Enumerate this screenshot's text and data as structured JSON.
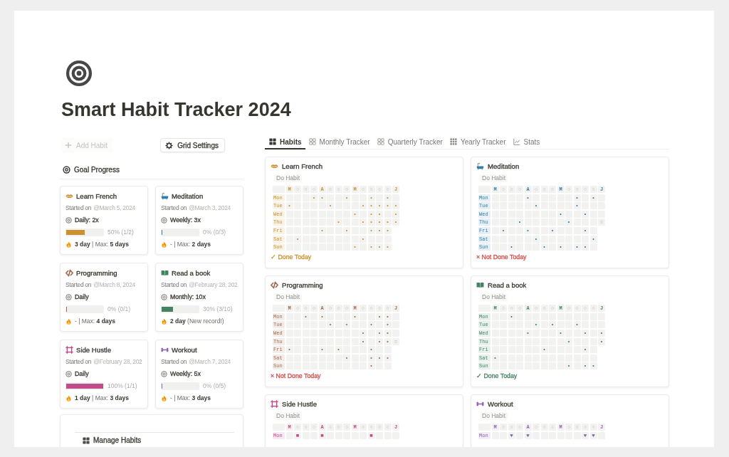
{
  "page": {
    "title": "Smart Habit Tracker 2024"
  },
  "toolbar": {
    "add_button": {
      "label": "Add Habit",
      "disabled": true
    },
    "settings_button": {
      "label": "Grid Settings"
    }
  },
  "goal_progress": {
    "heading": "Goal Progress",
    "cards": [
      {
        "title": "Learn French",
        "color": "#cb912f",
        "started_label": "Started on",
        "date": "@March 5, 2024",
        "frequency": "Daily: 2x",
        "level": 0.5,
        "progress": "50% (1/2)",
        "streak": "**3 day** | Max: **5 days**"
      },
      {
        "title": "Meditation",
        "color": "#337ea9",
        "started_label": "Started on",
        "date": "@March 3, 2024",
        "frequency": "Weekly: 3x",
        "level": 0,
        "progress": "0% (0/3)",
        "streak": "- | Max: **2 days**"
      },
      {
        "title": "Programming",
        "color": "#9f6b53",
        "started_label": "Started on",
        "date": "@March 8, 2024",
        "frequency": "Daily",
        "level": 0,
        "progress": "0% (0/1)",
        "streak": "- | Max: **4 days**"
      },
      {
        "title": "Read a book",
        "color": "#448361",
        "started_label": "Started on",
        "date": "@February 28, 202",
        "frequency": "Monthly: 10x",
        "level": 0.3,
        "progress": "30% (3/10)",
        "streak": "**2 day** (New record!)"
      },
      {
        "title": "Side Hustle",
        "color": "#c14c8a",
        "started_label": "Started on",
        "date": "@February 28, 202",
        "frequency": "Daily",
        "level": 1,
        "progress": "100% (1/1)",
        "streak": "**1 day** | Max: **3 days**"
      },
      {
        "title": "Workout",
        "color": "#9065b0",
        "started_label": "Started on",
        "date": "@March 7, 2024",
        "frequency": "Weekly: 5x",
        "level": 0,
        "progress": "0% (0/5)",
        "streak": "- | Max: **3 days**"
      }
    ]
  },
  "manage": {
    "label": "Manage Habits"
  },
  "tabs": [
    {
      "label": "Habits",
      "selected": true
    },
    {
      "label": "Monthly Tracker",
      "selected": false
    },
    {
      "label": "Quarterly Tracker",
      "selected": false
    },
    {
      "label": "Yearly Tracker",
      "selected": false
    },
    {
      "label": "Stats",
      "selected": false
    }
  ],
  "habits": [
    {
      "title": "Learn French",
      "color": "#cb912f",
      "action": "Do Habit",
      "weeks": [
        {
          "label": "M",
          "kind": "month"
        },
        {
          "label": "○",
          "kind": "week"
        },
        {
          "label": "○",
          "kind": "week"
        },
        {
          "label": "○",
          "kind": "week"
        },
        {
          "label": "A",
          "kind": "month"
        },
        {
          "label": "○",
          "kind": "week"
        },
        {
          "label": "○",
          "kind": "week"
        },
        {
          "label": "○",
          "kind": "week"
        },
        {
          "label": "M",
          "kind": "month"
        },
        {
          "label": "○",
          "kind": "week"
        },
        {
          "label": "○",
          "kind": "week"
        },
        {
          "label": "○",
          "kind": "week"
        },
        {
          "label": "○",
          "kind": "week"
        },
        {
          "label": "J",
          "kind": "month"
        }
      ],
      "rows": [
        {
          "day": "Mon",
          "cells": [
            null,
            null,
            null,
            {
              "mark": "•",
              "done": true
            },
            {
              "mark": "•",
              "done": true
            },
            null,
            null,
            {
              "mark": "•",
              "done": true
            },
            null,
            null,
            {
              "mark": "•",
              "done": true
            },
            null,
            {
              "mark": "•",
              "done": true
            },
            null
          ]
        },
        {
          "day": "Tue",
          "cells": [
            {
              "mark": "•",
              "done": true
            },
            null,
            null,
            null,
            null,
            {
              "mark": "•",
              "done": true
            },
            null,
            null,
            null,
            {
              "mark": "•",
              "done": true
            },
            {
              "mark": "•",
              "done": true
            },
            {
              "mark": "•",
              "done": true
            },
            {
              "mark": "•",
              "done": true
            },
            {
              "mark": "•",
              "done": true
            }
          ]
        },
        {
          "day": "Wed",
          "cells": [
            null,
            null,
            null,
            null,
            null,
            null,
            null,
            null,
            {
              "mark": "•",
              "done": true
            },
            null,
            {
              "mark": "•",
              "done": true
            },
            {
              "mark": "•",
              "done": true
            },
            null,
            {
              "mark": "•",
              "done": true
            }
          ]
        },
        {
          "day": "Thu",
          "cells": [
            null,
            null,
            null,
            null,
            null,
            null,
            {
              "mark": "•",
              "done": true
            },
            null,
            null,
            {
              "mark": "•",
              "done": true
            },
            {
              "mark": "•",
              "done": true
            },
            {
              "mark": "•",
              "done": true
            },
            {
              "mark": "•",
              "done": true
            },
            {
              "mark": "•",
              "done": true
            }
          ]
        },
        {
          "day": "Fri",
          "cells": [
            null,
            null,
            null,
            null,
            {
              "mark": "•",
              "done": true
            },
            null,
            null,
            {
              "mark": "•",
              "done": true
            },
            null,
            null,
            {
              "mark": "•",
              "done": true
            },
            {
              "mark": "•",
              "done": true
            },
            {
              "mark": "•",
              "done": true
            }
          ]
        },
        {
          "day": "Sat",
          "cells": [
            null,
            {
              "mark": "•",
              "done": true
            },
            null,
            null,
            null,
            null,
            null,
            null,
            null,
            {
              "mark": "•",
              "done": true
            },
            null,
            null,
            null
          ]
        },
        {
          "day": "Sun",
          "cells": [
            null,
            null,
            null,
            null,
            null,
            null,
            null,
            null,
            {
              "mark": "•",
              "done": true
            },
            null,
            {
              "mark": "•",
              "done": true
            },
            {
              "mark": "•",
              "done": true
            },
            {
              "mark": "•",
              "done": true
            }
          ]
        }
      ],
      "status": {
        "label": "✓ Done Today",
        "done": true
      }
    },
    {
      "title": "Meditation",
      "color": "#337ea9",
      "action": "Do Habit",
      "weeks": [
        {
          "label": "M",
          "kind": "month"
        },
        {
          "label": "○",
          "kind": "week"
        },
        {
          "label": "○",
          "kind": "week"
        },
        {
          "label": "○",
          "kind": "week"
        },
        {
          "label": "A",
          "kind": "month"
        },
        {
          "label": "○",
          "kind": "week"
        },
        {
          "label": "○",
          "kind": "week"
        },
        {
          "label": "○",
          "kind": "week"
        },
        {
          "label": "M",
          "kind": "month"
        },
        {
          "label": "○",
          "kind": "week"
        },
        {
          "label": "○",
          "kind": "week"
        },
        {
          "label": "○",
          "kind": "week"
        },
        {
          "label": "○",
          "kind": "week"
        },
        {
          "label": "J",
          "kind": "month"
        }
      ],
      "rows": [
        {
          "day": "Mon",
          "cells": [
            null,
            null,
            null,
            null,
            {
              "mark": "•",
              "done": true
            },
            null,
            null,
            null,
            null,
            null,
            {
              "mark": "•",
              "done": true
            },
            null,
            {
              "mark": "•",
              "done": true
            },
            null
          ]
        },
        {
          "day": "Tue",
          "cells": [
            null,
            null,
            null,
            null,
            null,
            {
              "mark": "•",
              "done": true
            },
            null,
            null,
            null,
            null,
            {
              "mark": "•",
              "done": true
            },
            null,
            null,
            null
          ]
        },
        {
          "day": "Wed",
          "cells": [
            null,
            null,
            null,
            null,
            null,
            null,
            null,
            null,
            {
              "mark": "•",
              "done": true
            },
            null,
            null,
            {
              "mark": "•",
              "done": true
            },
            null,
            null
          ]
        },
        {
          "day": "Thu",
          "cells": [
            null,
            null,
            null,
            {
              "mark": "•",
              "done": true
            },
            null,
            null,
            null,
            null,
            null,
            {
              "mark": "•",
              "done": true
            },
            null,
            null,
            null,
            {
              "mark": "○",
              "done": false
            }
          ]
        },
        {
          "day": "Fri",
          "cells": [
            null,
            {
              "mark": "•",
              "done": true
            },
            null,
            null,
            {
              "mark": "•",
              "done": true
            },
            null,
            null,
            {
              "mark": "•",
              "done": true
            },
            null,
            null,
            null,
            {
              "mark": "•",
              "done": true
            },
            null
          ]
        },
        {
          "day": "Sat",
          "cells": [
            null,
            null,
            null,
            null,
            null,
            {
              "mark": "•",
              "done": true
            },
            null,
            null,
            null,
            null,
            null,
            null,
            {
              "mark": "•",
              "done": true
            }
          ]
        },
        {
          "day": "Sun",
          "cells": [
            null,
            null,
            {
              "mark": "•",
              "done": true
            },
            null,
            null,
            null,
            {
              "mark": "•",
              "done": true
            },
            null,
            {
              "mark": "•",
              "done": true
            },
            null,
            {
              "mark": "•",
              "done": true
            },
            {
              "mark": "•",
              "done": true
            },
            null
          ]
        }
      ],
      "status": {
        "label": "× Not Done Today",
        "done": false
      }
    },
    {
      "title": "Programming",
      "color": "#9f6b53",
      "action": "Do Habit",
      "weeks": [
        {
          "label": "M",
          "kind": "month"
        },
        {
          "label": "○",
          "kind": "week"
        },
        {
          "label": "○",
          "kind": "week"
        },
        {
          "label": "○",
          "kind": "week"
        },
        {
          "label": "A",
          "kind": "month"
        },
        {
          "label": "○",
          "kind": "week"
        },
        {
          "label": "○",
          "kind": "week"
        },
        {
          "label": "○",
          "kind": "week"
        },
        {
          "label": "M",
          "kind": "month"
        },
        {
          "label": "○",
          "kind": "week"
        },
        {
          "label": "○",
          "kind": "week"
        },
        {
          "label": "○",
          "kind": "week"
        },
        {
          "label": "○",
          "kind": "week"
        },
        {
          "label": "J",
          "kind": "month"
        }
      ],
      "rows": [
        {
          "day": "Mon",
          "cells": [
            null,
            null,
            {
              "mark": "•",
              "done": true
            },
            null,
            {
              "mark": "•",
              "done": true
            },
            null,
            null,
            null,
            {
              "mark": "•",
              "done": true
            },
            null,
            null,
            {
              "mark": "•",
              "done": true
            },
            {
              "mark": "•",
              "done": true
            },
            null
          ]
        },
        {
          "day": "Tue",
          "cells": [
            null,
            null,
            null,
            null,
            null,
            {
              "mark": "•",
              "done": true
            },
            null,
            {
              "mark": "•",
              "done": true
            },
            null,
            null,
            {
              "mark": "•",
              "done": true
            },
            null,
            {
              "mark": "•",
              "done": true
            },
            null
          ]
        },
        {
          "day": "Wed",
          "cells": [
            null,
            null,
            null,
            null,
            null,
            null,
            null,
            null,
            null,
            {
              "mark": "•",
              "done": true
            },
            null,
            {
              "mark": "•",
              "done": true
            },
            {
              "mark": "•",
              "done": true
            },
            null
          ]
        },
        {
          "day": "Thu",
          "cells": [
            null,
            null,
            null,
            null,
            null,
            null,
            null,
            null,
            null,
            {
              "mark": "•",
              "done": true
            },
            null,
            {
              "mark": "•",
              "done": true
            },
            {
              "mark": "•",
              "done": true
            },
            {
              "mark": "○",
              "done": false
            }
          ]
        },
        {
          "day": "Fri",
          "cells": [
            {
              "mark": "•",
              "done": true
            },
            null,
            null,
            null,
            {
              "mark": "•",
              "done": true
            },
            null,
            {
              "mark": "•",
              "done": true
            },
            null,
            null,
            null,
            {
              "mark": "•",
              "done": true
            },
            null,
            null
          ]
        },
        {
          "day": "Sat",
          "cells": [
            null,
            null,
            null,
            null,
            null,
            null,
            null,
            {
              "mark": "•",
              "done": true
            },
            null,
            null,
            {
              "mark": "•",
              "done": true
            },
            {
              "mark": "•",
              "done": true
            },
            {
              "mark": "•",
              "done": true
            }
          ]
        },
        {
          "day": "Sun",
          "cells": [
            null,
            null,
            null,
            null,
            null,
            null,
            null,
            null,
            null,
            null,
            {
              "mark": "•",
              "done": true
            },
            null,
            null
          ]
        }
      ],
      "status": {
        "label": "× Not Done Today",
        "done": false
      }
    },
    {
      "title": "Read a book",
      "color": "#448361",
      "action": "Do Habit",
      "weeks": [
        {
          "label": "M",
          "kind": "month"
        },
        {
          "label": "○",
          "kind": "week"
        },
        {
          "label": "○",
          "kind": "week"
        },
        {
          "label": "○",
          "kind": "week"
        },
        {
          "label": "A",
          "kind": "month"
        },
        {
          "label": "○",
          "kind": "week"
        },
        {
          "label": "○",
          "kind": "week"
        },
        {
          "label": "○",
          "kind": "week"
        },
        {
          "label": "M",
          "kind": "month"
        },
        {
          "label": "○",
          "kind": "week"
        },
        {
          "label": "○",
          "kind": "week"
        },
        {
          "label": "○",
          "kind": "week"
        },
        {
          "label": "○",
          "kind": "week"
        },
        {
          "label": "J",
          "kind": "month"
        }
      ],
      "rows": [
        {
          "day": "Mon",
          "cells": [
            null,
            null,
            {
              "mark": "•",
              "done": true
            },
            null,
            null,
            null,
            null,
            null,
            null,
            null,
            null,
            null,
            null,
            null
          ]
        },
        {
          "day": "Tue",
          "cells": [
            null,
            null,
            null,
            null,
            null,
            {
              "mark": "•",
              "done": true
            },
            null,
            {
              "mark": "•",
              "done": true
            },
            null,
            null,
            {
              "mark": "•",
              "done": true
            },
            null,
            null,
            null
          ]
        },
        {
          "day": "Wed",
          "cells": [
            null,
            null,
            null,
            null,
            {
              "mark": "•",
              "done": true
            },
            null,
            null,
            null,
            {
              "mark": "•",
              "done": true
            },
            null,
            null,
            {
              "mark": "•",
              "done": true
            },
            null,
            {
              "mark": "•",
              "done": true
            }
          ]
        },
        {
          "day": "Thu",
          "cells": [
            null,
            null,
            null,
            null,
            null,
            null,
            null,
            null,
            null,
            {
              "mark": "•",
              "done": true
            },
            null,
            null,
            null,
            {
              "mark": "•",
              "done": true
            }
          ]
        },
        {
          "day": "Fri",
          "cells": [
            null,
            null,
            null,
            null,
            null,
            null,
            {
              "mark": "•",
              "done": true
            },
            null,
            null,
            null,
            null,
            {
              "mark": "•",
              "done": true
            },
            null
          ]
        },
        {
          "day": "Sat",
          "cells": [
            {
              "mark": "•",
              "done": true
            },
            null,
            null,
            null,
            null,
            null,
            null,
            null,
            null,
            null,
            null,
            null,
            null
          ]
        },
        {
          "day": "Sun",
          "cells": [
            null,
            null,
            null,
            null,
            null,
            null,
            null,
            null,
            null,
            {
              "mark": "•",
              "done": true
            },
            null,
            {
              "mark": "•",
              "done": true
            },
            {
              "mark": "•",
              "done": true
            }
          ]
        }
      ],
      "status": {
        "label": "✓ Done Today",
        "done": true
      }
    },
    {
      "title": "Side Hustle",
      "color": "#c14c8a",
      "action": "Do Habit",
      "weeks": [
        {
          "label": "M",
          "kind": "month"
        },
        {
          "label": "○",
          "kind": "week"
        },
        {
          "label": "○",
          "kind": "week"
        },
        {
          "label": "○",
          "kind": "week"
        },
        {
          "label": "A",
          "kind": "month"
        },
        {
          "label": "○",
          "kind": "week"
        },
        {
          "label": "○",
          "kind": "week"
        },
        {
          "label": "○",
          "kind": "week"
        },
        {
          "label": "M",
          "kind": "month"
        },
        {
          "label": "○",
          "kind": "week"
        },
        {
          "label": "○",
          "kind": "week"
        },
        {
          "label": "○",
          "kind": "week"
        },
        {
          "label": "○",
          "kind": "week"
        },
        {
          "label": "J",
          "kind": "month"
        }
      ],
      "rows": [
        {
          "day": "Mon",
          "cells": [
            null,
            {
              "mark": "■",
              "done": true
            },
            null,
            null,
            {
              "mark": "■",
              "done": true
            },
            null,
            null,
            null,
            null,
            null,
            {
              "mark": "■",
              "done": true
            },
            null,
            null,
            null
          ]
        }
      ]
    },
    {
      "title": "Workout",
      "color": "#9065b0",
      "action": "Do Habit",
      "weeks": [
        {
          "label": "M",
          "kind": "month"
        },
        {
          "label": "○",
          "kind": "week"
        },
        {
          "label": "○",
          "kind": "week"
        },
        {
          "label": "○",
          "kind": "week"
        },
        {
          "label": "A",
          "kind": "month"
        },
        {
          "label": "○",
          "kind": "week"
        },
        {
          "label": "○",
          "kind": "week"
        },
        {
          "label": "○",
          "kind": "week"
        },
        {
          "label": "M",
          "kind": "month"
        },
        {
          "label": "○",
          "kind": "week"
        },
        {
          "label": "○",
          "kind": "week"
        },
        {
          "label": "○",
          "kind": "week"
        },
        {
          "label": "○",
          "kind": "week"
        },
        {
          "label": "J",
          "kind": "month"
        }
      ],
      "rows": [
        {
          "day": "Mon",
          "cells": [
            null,
            null,
            {
              "mark": "♥",
              "done": true
            },
            null,
            {
              "mark": "♥",
              "done": true
            },
            null,
            null,
            null,
            null,
            null,
            null,
            {
              "mark": "♥",
              "done": true
            },
            {
              "mark": "♥",
              "done": true
            },
            null
          ]
        }
      ]
    }
  ]
}
